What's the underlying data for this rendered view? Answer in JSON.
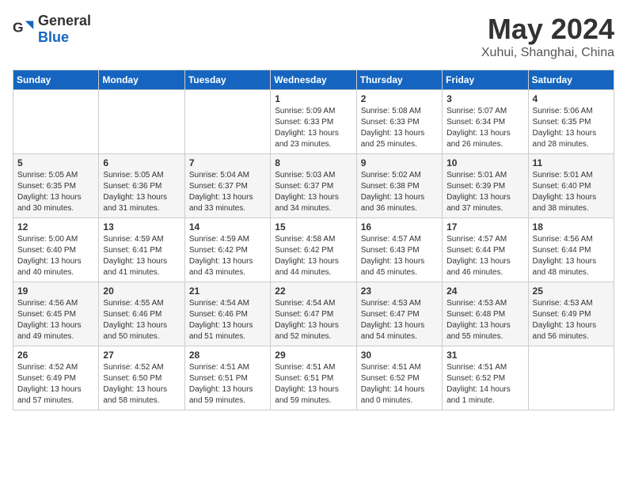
{
  "header": {
    "logo_general": "General",
    "logo_blue": "Blue",
    "month": "May 2024",
    "location": "Xuhui, Shanghai, China"
  },
  "weekdays": [
    "Sunday",
    "Monday",
    "Tuesday",
    "Wednesday",
    "Thursday",
    "Friday",
    "Saturday"
  ],
  "weeks": [
    [
      {
        "day": "",
        "info": ""
      },
      {
        "day": "",
        "info": ""
      },
      {
        "day": "",
        "info": ""
      },
      {
        "day": "1",
        "info": "Sunrise: 5:09 AM\nSunset: 6:33 PM\nDaylight: 13 hours\nand 23 minutes."
      },
      {
        "day": "2",
        "info": "Sunrise: 5:08 AM\nSunset: 6:33 PM\nDaylight: 13 hours\nand 25 minutes."
      },
      {
        "day": "3",
        "info": "Sunrise: 5:07 AM\nSunset: 6:34 PM\nDaylight: 13 hours\nand 26 minutes."
      },
      {
        "day": "4",
        "info": "Sunrise: 5:06 AM\nSunset: 6:35 PM\nDaylight: 13 hours\nand 28 minutes."
      }
    ],
    [
      {
        "day": "5",
        "info": "Sunrise: 5:05 AM\nSunset: 6:35 PM\nDaylight: 13 hours\nand 30 minutes."
      },
      {
        "day": "6",
        "info": "Sunrise: 5:05 AM\nSunset: 6:36 PM\nDaylight: 13 hours\nand 31 minutes."
      },
      {
        "day": "7",
        "info": "Sunrise: 5:04 AM\nSunset: 6:37 PM\nDaylight: 13 hours\nand 33 minutes."
      },
      {
        "day": "8",
        "info": "Sunrise: 5:03 AM\nSunset: 6:37 PM\nDaylight: 13 hours\nand 34 minutes."
      },
      {
        "day": "9",
        "info": "Sunrise: 5:02 AM\nSunset: 6:38 PM\nDaylight: 13 hours\nand 36 minutes."
      },
      {
        "day": "10",
        "info": "Sunrise: 5:01 AM\nSunset: 6:39 PM\nDaylight: 13 hours\nand 37 minutes."
      },
      {
        "day": "11",
        "info": "Sunrise: 5:01 AM\nSunset: 6:40 PM\nDaylight: 13 hours\nand 38 minutes."
      }
    ],
    [
      {
        "day": "12",
        "info": "Sunrise: 5:00 AM\nSunset: 6:40 PM\nDaylight: 13 hours\nand 40 minutes."
      },
      {
        "day": "13",
        "info": "Sunrise: 4:59 AM\nSunset: 6:41 PM\nDaylight: 13 hours\nand 41 minutes."
      },
      {
        "day": "14",
        "info": "Sunrise: 4:59 AM\nSunset: 6:42 PM\nDaylight: 13 hours\nand 43 minutes."
      },
      {
        "day": "15",
        "info": "Sunrise: 4:58 AM\nSunset: 6:42 PM\nDaylight: 13 hours\nand 44 minutes."
      },
      {
        "day": "16",
        "info": "Sunrise: 4:57 AM\nSunset: 6:43 PM\nDaylight: 13 hours\nand 45 minutes."
      },
      {
        "day": "17",
        "info": "Sunrise: 4:57 AM\nSunset: 6:44 PM\nDaylight: 13 hours\nand 46 minutes."
      },
      {
        "day": "18",
        "info": "Sunrise: 4:56 AM\nSunset: 6:44 PM\nDaylight: 13 hours\nand 48 minutes."
      }
    ],
    [
      {
        "day": "19",
        "info": "Sunrise: 4:56 AM\nSunset: 6:45 PM\nDaylight: 13 hours\nand 49 minutes."
      },
      {
        "day": "20",
        "info": "Sunrise: 4:55 AM\nSunset: 6:46 PM\nDaylight: 13 hours\nand 50 minutes."
      },
      {
        "day": "21",
        "info": "Sunrise: 4:54 AM\nSunset: 6:46 PM\nDaylight: 13 hours\nand 51 minutes."
      },
      {
        "day": "22",
        "info": "Sunrise: 4:54 AM\nSunset: 6:47 PM\nDaylight: 13 hours\nand 52 minutes."
      },
      {
        "day": "23",
        "info": "Sunrise: 4:53 AM\nSunset: 6:47 PM\nDaylight: 13 hours\nand 54 minutes."
      },
      {
        "day": "24",
        "info": "Sunrise: 4:53 AM\nSunset: 6:48 PM\nDaylight: 13 hours\nand 55 minutes."
      },
      {
        "day": "25",
        "info": "Sunrise: 4:53 AM\nSunset: 6:49 PM\nDaylight: 13 hours\nand 56 minutes."
      }
    ],
    [
      {
        "day": "26",
        "info": "Sunrise: 4:52 AM\nSunset: 6:49 PM\nDaylight: 13 hours\nand 57 minutes."
      },
      {
        "day": "27",
        "info": "Sunrise: 4:52 AM\nSunset: 6:50 PM\nDaylight: 13 hours\nand 58 minutes."
      },
      {
        "day": "28",
        "info": "Sunrise: 4:51 AM\nSunset: 6:51 PM\nDaylight: 13 hours\nand 59 minutes."
      },
      {
        "day": "29",
        "info": "Sunrise: 4:51 AM\nSunset: 6:51 PM\nDaylight: 13 hours\nand 59 minutes."
      },
      {
        "day": "30",
        "info": "Sunrise: 4:51 AM\nSunset: 6:52 PM\nDaylight: 14 hours\nand 0 minutes."
      },
      {
        "day": "31",
        "info": "Sunrise: 4:51 AM\nSunset: 6:52 PM\nDaylight: 14 hours\nand 1 minute."
      },
      {
        "day": "",
        "info": ""
      }
    ]
  ]
}
